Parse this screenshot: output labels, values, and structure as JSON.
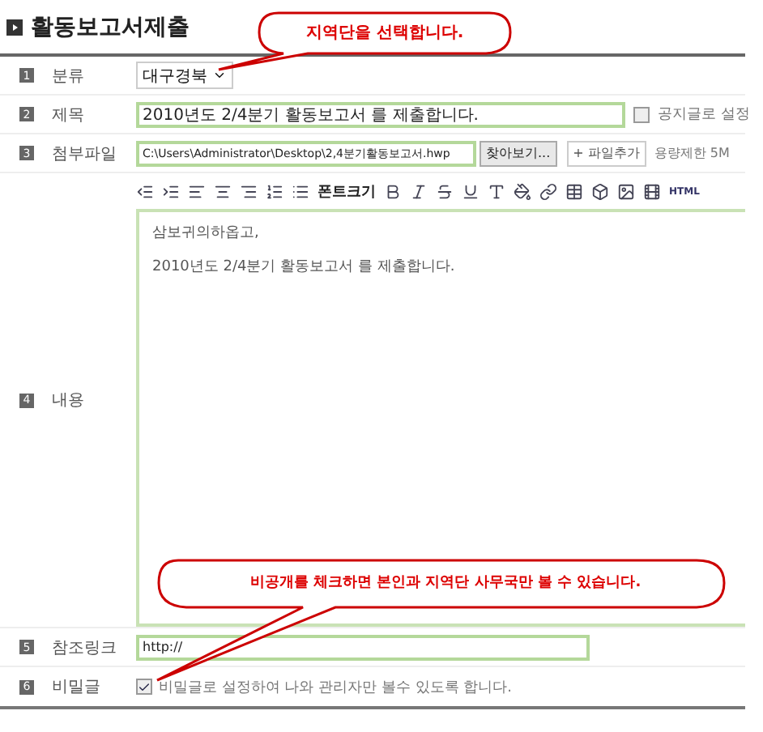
{
  "title": "활동보고서제출",
  "callouts": [
    {
      "kind": "top",
      "text": "지역단을  선택합니다."
    },
    {
      "kind": "bottom",
      "text": "비공개를 체크하면 본인과 지역단 사무국만 볼 수 있습니다."
    }
  ],
  "rows": [
    {
      "number": "1",
      "label": "분류",
      "kind": "select",
      "value": "대구경북"
    },
    {
      "number": "2",
      "label": "제목",
      "kind": "title",
      "value": "2010년도 2/4분기 활동보고서 를 제출합니다.",
      "notice": {
        "label": "공지글로 설정",
        "checked": false
      }
    },
    {
      "number": "3",
      "label": "첨부파일",
      "kind": "file",
      "value": "C:\\Users\\Administrator\\Desktop\\2,4분기활동보고서.hwp",
      "browse": "찾아보기...",
      "add": "+ 파일추가",
      "limit": "용량제한 5M"
    },
    {
      "number": "4",
      "label": "내용",
      "kind": "editor",
      "font_size": "폰트크기",
      "html": "HTML",
      "lines": [
        "삼보귀의하옵고,",
        "2010년도 2/4분기 활동보고서 를 제출합니다."
      ]
    },
    {
      "number": "5",
      "label": "참조링크",
      "kind": "link",
      "value": "http://"
    },
    {
      "number": "6",
      "label": "비밀글",
      "kind": "secret",
      "checked": true,
      "text": "비밀글로 설정하여 나와 관리자만 볼수 있도록 합니다."
    }
  ]
}
